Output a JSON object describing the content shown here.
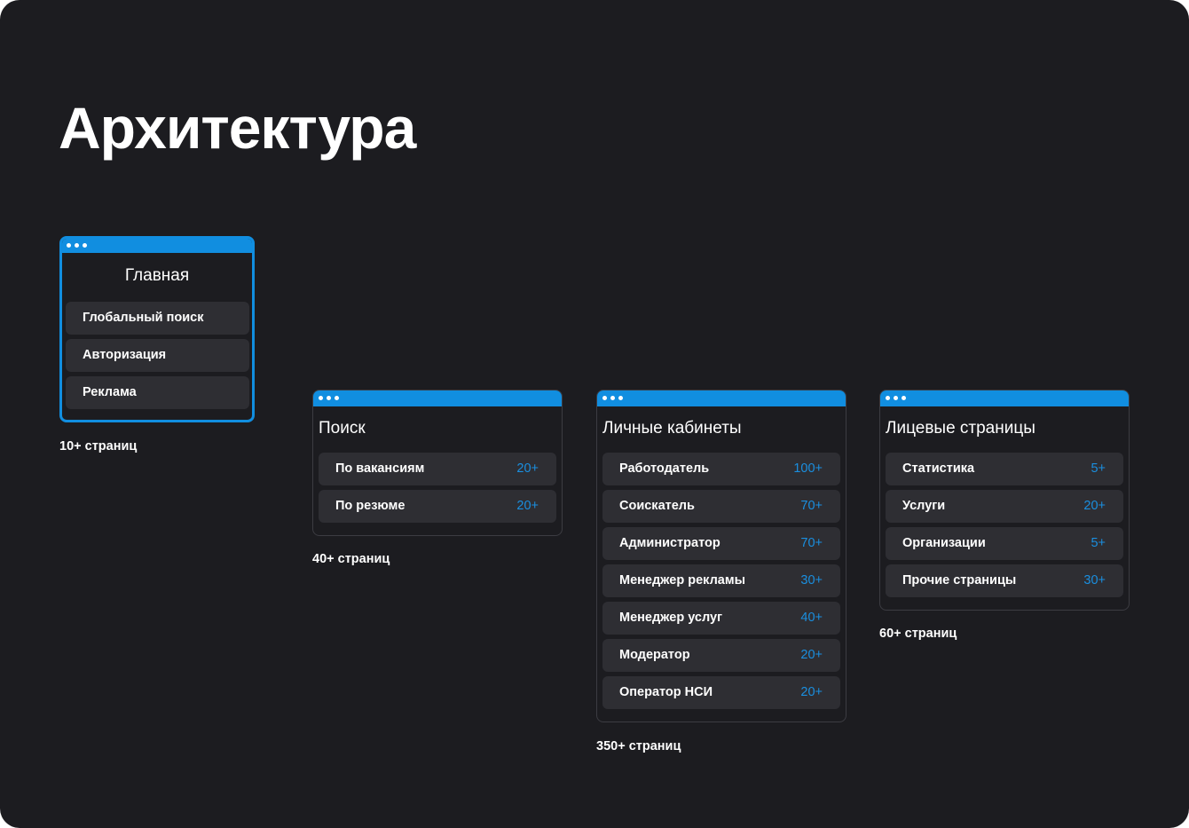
{
  "title": "Архитектура",
  "colors": {
    "background": "#1c1c20",
    "accent": "#118ee0",
    "row": "#2e2e33",
    "count": "#1a8fe0"
  },
  "main": {
    "title": "Главная",
    "items": [
      "Глобальный поиск",
      "Авторизация",
      "Реклама"
    ],
    "caption": "10+ страниц"
  },
  "search": {
    "title": "Поиск",
    "items": [
      {
        "label": "По вакансиям",
        "count": "20+"
      },
      {
        "label": "По резюме",
        "count": "20+"
      }
    ],
    "caption": "40+ страниц"
  },
  "cabinets": {
    "title": "Личные кабинеты",
    "items": [
      {
        "label": "Работодатель",
        "count": "100+"
      },
      {
        "label": "Соискатель",
        "count": "70+"
      },
      {
        "label": "Администратор",
        "count": "70+"
      },
      {
        "label": "Менеджер рекламы",
        "count": "30+"
      },
      {
        "label": "Менеджер услуг",
        "count": "40+"
      },
      {
        "label": "Модератор",
        "count": "20+"
      },
      {
        "label": "Оператор НСИ",
        "count": "20+"
      }
    ],
    "caption": "350+ страниц"
  },
  "public_pages": {
    "title": "Лицевые страницы",
    "items": [
      {
        "label": "Статистика",
        "count": "5+"
      },
      {
        "label": "Услуги",
        "count": "20+"
      },
      {
        "label": "Организации",
        "count": "5+"
      },
      {
        "label": "Прочие страницы",
        "count": "30+"
      }
    ],
    "caption": "60+ страниц"
  }
}
